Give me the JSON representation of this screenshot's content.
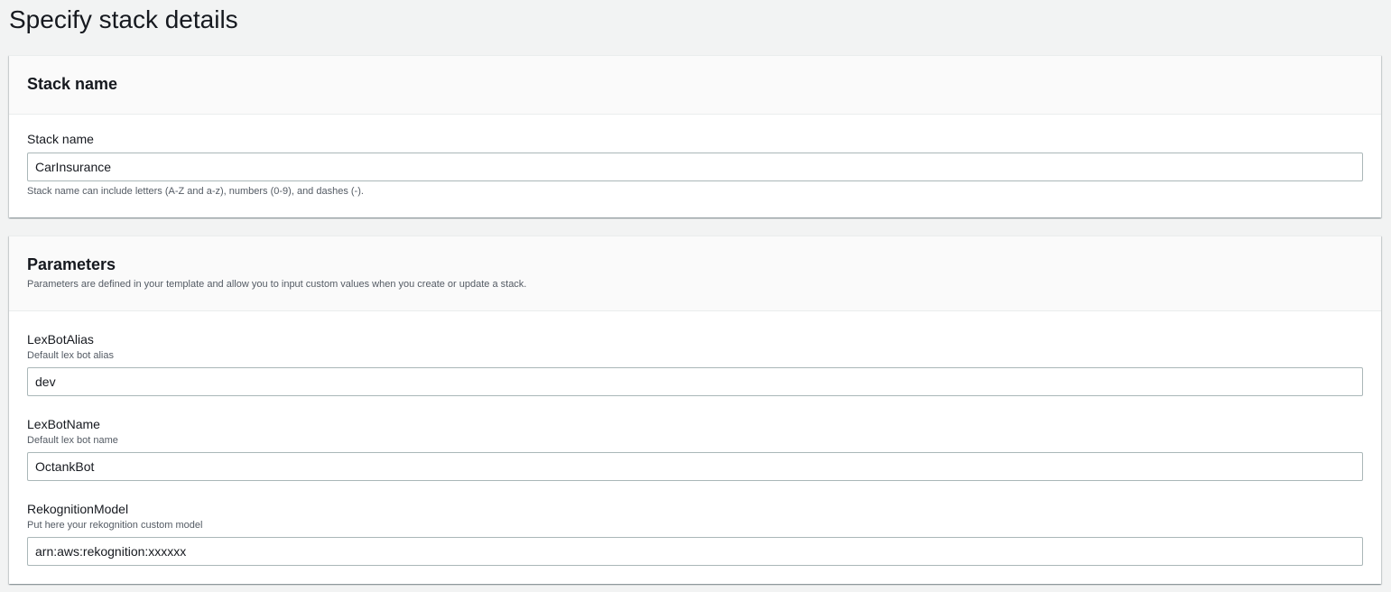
{
  "page": {
    "title": "Specify stack details"
  },
  "stack_name_panel": {
    "heading": "Stack name",
    "field": {
      "label": "Stack name",
      "value": "CarInsurance",
      "hint": "Stack name can include letters (A-Z and a-z), numbers (0-9), and dashes (-)."
    }
  },
  "parameters_panel": {
    "heading": "Parameters",
    "description": "Parameters are defined in your template and allow you to input custom values when you create or update a stack.",
    "fields": [
      {
        "label": "LexBotAlias",
        "description": "Default lex bot alias",
        "value": "dev"
      },
      {
        "label": "LexBotName",
        "description": "Default lex bot name",
        "value": "OctankBot"
      },
      {
        "label": "RekognitionModel",
        "description": "Put here your rekognition custom model",
        "value": "arn:aws:rekognition:xxxxxx"
      }
    ]
  }
}
